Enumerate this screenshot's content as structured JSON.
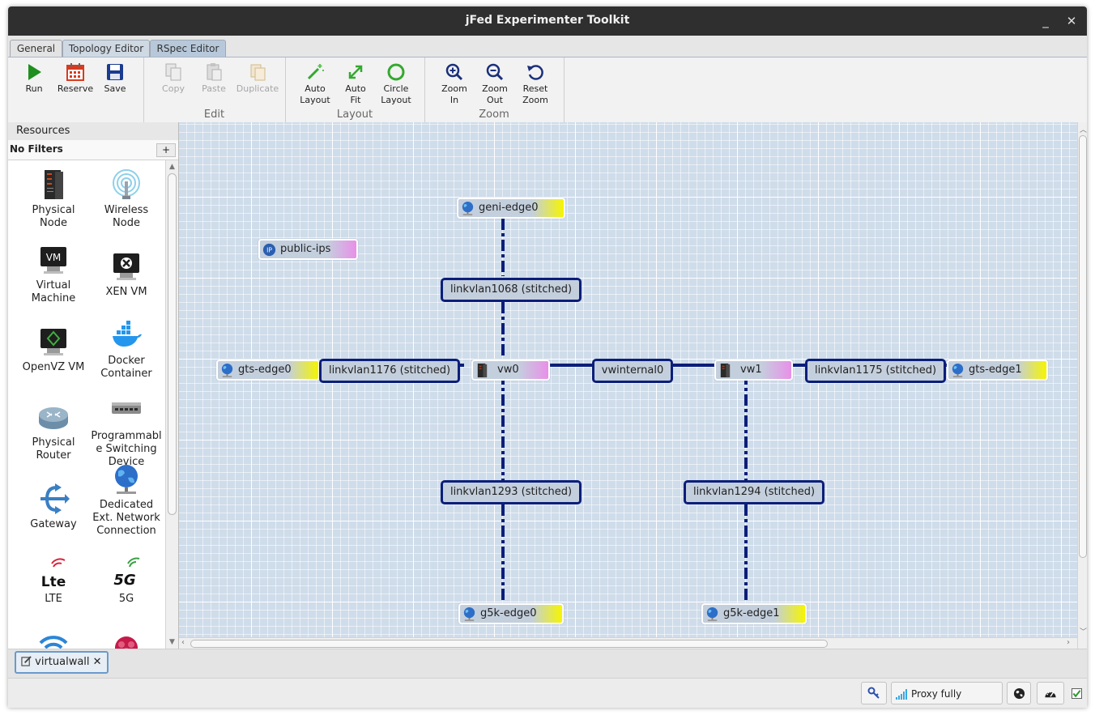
{
  "window": {
    "title": "jFed Experimenter Toolkit"
  },
  "tabs": [
    {
      "label": "General"
    },
    {
      "label": "Topology Editor"
    },
    {
      "label": "RSpec Editor"
    }
  ],
  "toolbar": {
    "run": "Run",
    "reserve": "Reserve",
    "save": "Save",
    "copy": "Copy",
    "paste": "Paste",
    "duplicate": "Duplicate",
    "edit_group": "Edit",
    "auto_layout": [
      "Auto",
      "Layout"
    ],
    "auto_fit": [
      "Auto",
      "Fit"
    ],
    "circle_layout": [
      "Circle",
      "Layout"
    ],
    "layout_group": "Layout",
    "zoom_in": [
      "Zoom",
      "In"
    ],
    "zoom_out": [
      "Zoom",
      "Out"
    ],
    "reset_zoom": [
      "Reset",
      "Zoom"
    ],
    "zoom_group": "Zoom"
  },
  "sidebar": {
    "title": "Resources",
    "filter": "No Filters",
    "add": "+",
    "items": [
      {
        "label": [
          "Physical",
          "Node"
        ]
      },
      {
        "label": [
          "Wireless",
          "Node"
        ]
      },
      {
        "label": [
          "Virtual",
          "Machine"
        ]
      },
      {
        "label": [
          "XEN VM"
        ]
      },
      {
        "label": [
          "OpenVZ VM"
        ]
      },
      {
        "label": [
          "Docker",
          "Container"
        ]
      },
      {
        "label": [
          "Physical",
          "Router"
        ]
      },
      {
        "label": [
          "Programmabl",
          "e Switching",
          "Device"
        ]
      },
      {
        "label": [
          "Gateway"
        ]
      },
      {
        "label": [
          "Dedicated",
          "Ext. Network",
          "Connection"
        ]
      },
      {
        "label": [
          "LTE"
        ]
      },
      {
        "label": [
          "5G"
        ]
      }
    ]
  },
  "topology": {
    "nodes": {
      "geni_edge0": "geni-edge0",
      "public_ips": "public-ips",
      "gts_edge0": "gts-edge0",
      "vw0": "vw0",
      "vw1": "vw1",
      "gts_edge1": "gts-edge1",
      "g5k_edge0": "g5k-edge0",
      "g5k_edge1": "g5k-edge1"
    },
    "links": {
      "l1068": "linkvlan1068 (stitched)",
      "l1176": "linkvlan1176 (stitched)",
      "vwinternal0": "vwinternal0",
      "l1175": "linkvlan1175 (stitched)",
      "l1293": "linkvlan1293 (stitched)",
      "l1294": "linkvlan1294 (stitched)"
    },
    "link_color": "#0b1e7a"
  },
  "bottom_tab": {
    "label": "virtualwall",
    "close": "✕"
  },
  "status": {
    "proxy": "Proxy fully enabled"
  }
}
